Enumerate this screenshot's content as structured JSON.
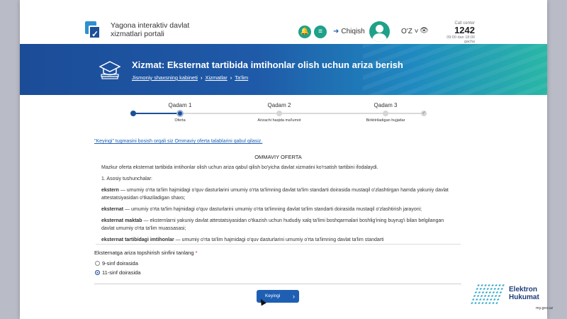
{
  "header": {
    "portal_title": "Yagona interaktiv davlat xizmatlari portali",
    "exit_label": "Chiqish",
    "lang": "O'Z",
    "call_center_label": "Call center",
    "call_center_number": "1242",
    "call_center_hours": "09:00 dan 18:00 gacha"
  },
  "banner": {
    "title": "Xizmat: Eksternat tartibida imtihonlar olish uchun ariza berish",
    "breadcrumbs": [
      "Jismoniy shaxsning kabineti",
      "Xizmatlar",
      "Ta'lim"
    ]
  },
  "stepper": {
    "steps": [
      {
        "title": "Qadam 1",
        "sub": "Oferta"
      },
      {
        "title": "Qadam 2",
        "sub": "Arizachi haqida ma'lumot"
      },
      {
        "title": "Qadam 3",
        "sub": "Biriktiriladigan hujjatlar"
      }
    ],
    "current_step": 1
  },
  "offer": {
    "notice": "\"Keyingi\" tugmasini bosish orqali siz Ommaviy oferta talablarini qabul qilasiz.",
    "title": "OMMAVIY OFERTA",
    "intro": "Mazkur oferta eksternat tartibida imtihonlar olish uchun ariza qabul qilish bo'yicha davlat xizmatini ko'rsatish tartibini ifodalaydi.",
    "section": "1. Asosiy tushunchalar:",
    "terms": [
      {
        "term": "ekstern",
        "text": " — umumiy o'rta ta'lim hajmidagi o'quv dasturlarini umumiy o'rta ta'limning davlat ta'lim standarti doirasida mustaqil o'zlashtirgan hamda yakuniy davlat attestatsiyasidan o'tkaziladigan shaxs;"
      },
      {
        "term": "eksternat",
        "text": " — umumiy o'rta ta'lim hajmidagi o'quv dasturlarini umumiy o'rta ta'limning davlat ta'lim standarti doirasida mustaqil o'zlashtirish jarayoni;"
      },
      {
        "term": "eksternat maktab",
        "text": " — eksternlarni yakuniy davlat attestatsiyasidan o'tkazish uchun hududiy xalq ta'limi boshqarmalari boshlig'ining buyrug'i bilan belgilangan davlat umumiy o'rta ta'lim muassasasi;"
      },
      {
        "term": "eksternat tartibidagi imtihonlar",
        "text": " — umumiy o'rta ta'lim hajmidagi o'quv dasturlarini umumiy o'rta ta'limning davlat ta'lim standarti"
      }
    ]
  },
  "form": {
    "question": "Eksternatga ariza topshirish sinfini tanlang",
    "required_mark": "*",
    "options": [
      {
        "label": "9-sinf doirasida",
        "selected": false
      },
      {
        "label": "11-sinf doirasida",
        "selected": true
      }
    ],
    "next_label": "Keyingi"
  },
  "watermark": {
    "line1": "Elektron",
    "line2": "Hukumat",
    "sub": "my.gov.uz"
  },
  "colors": {
    "primary": "#1e4f99",
    "accent": "#1fa189",
    "link": "#1e5fb4"
  }
}
